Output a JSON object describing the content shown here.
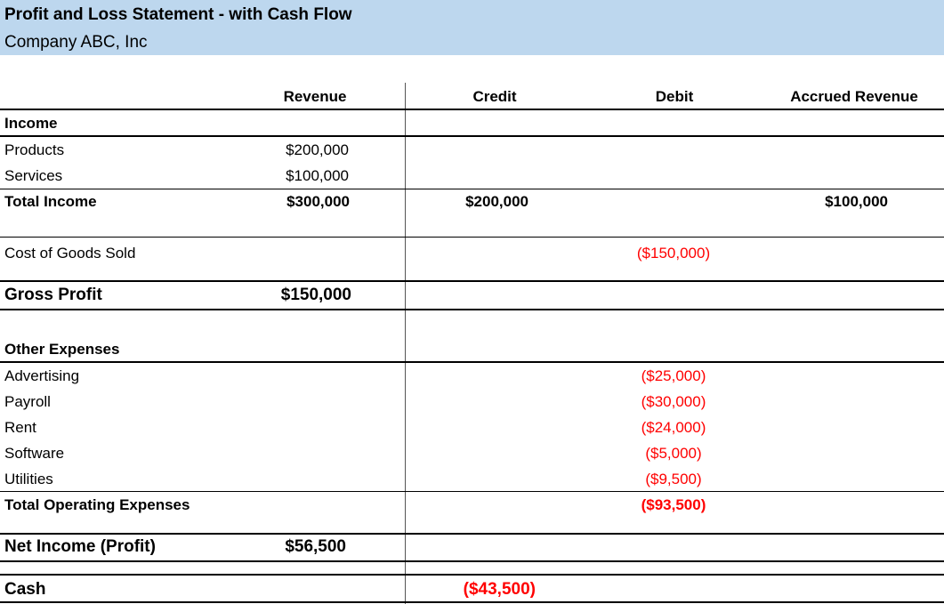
{
  "header": {
    "title": "Profit and Loss Statement - with Cash Flow",
    "company": "Company ABC, Inc"
  },
  "columns": {
    "revenue": "Revenue",
    "credit": "Credit",
    "debit": "Debit",
    "accrued": "Accrued Revenue"
  },
  "income": {
    "section": "Income",
    "products_label": "Products",
    "products_revenue": "$200,000",
    "services_label": "Services",
    "services_revenue": "$100,000",
    "total_label": "Total Income",
    "total_revenue": "$300,000",
    "total_credit": "$200,000",
    "total_accrued": "$100,000"
  },
  "cogs": {
    "label": "Cost of Goods Sold",
    "debit": "($150,000)"
  },
  "gross_profit": {
    "label": "Gross Profit",
    "revenue": "$150,000"
  },
  "expenses": {
    "section": "Other Expenses",
    "items": [
      {
        "label": "Advertising",
        "debit": "($25,000)"
      },
      {
        "label": "Payroll",
        "debit": "($30,000)"
      },
      {
        "label": "Rent",
        "debit": "($24,000)"
      },
      {
        "label": "Software",
        "debit": "($5,000)"
      },
      {
        "label": "Utilities",
        "debit": "($9,500)"
      }
    ],
    "total_label": "Total Operating Expenses",
    "total_debit": "($93,500)"
  },
  "net_income": {
    "label": "Net Income (Profit)",
    "revenue": "$56,500"
  },
  "cash": {
    "label": "Cash",
    "credit": "($43,500)"
  },
  "colors": {
    "header_band": "#bdd7ee",
    "negative": "#ff0000"
  }
}
